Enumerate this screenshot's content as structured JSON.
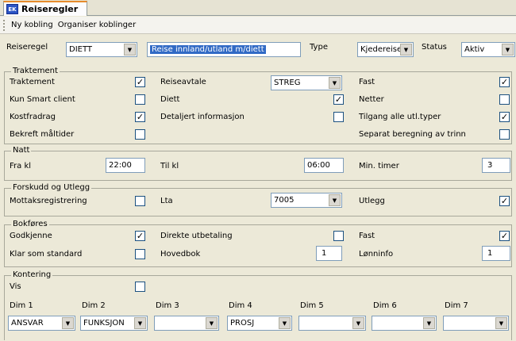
{
  "tab": {
    "icon": "EK",
    "title": "Reiseregler"
  },
  "toolbar": {
    "new_link": "Ny kobling",
    "organize": "Organiser koblinger"
  },
  "header": {
    "reiseregel_label": "Reiseregel",
    "reiseregel_value": "DIETT",
    "description": "Reise innland/utland m/diett",
    "type_label": "Type",
    "type_value": "Kjedereise",
    "status_label": "Status",
    "status_value": "Aktiv"
  },
  "traktement": {
    "title": "Traktement",
    "traktement": "Traktement",
    "kun_smart": "Kun Smart client",
    "kostfradrag": "Kostfradrag",
    "bekreft": "Bekreft måltider",
    "reiseavtale": "Reiseavtale",
    "reiseavtale_value": "STREG",
    "diett": "Diett",
    "detaljert": "Detaljert informasjon",
    "fast": "Fast",
    "netter": "Netter",
    "tilgang": "Tilgang alle utl.typer",
    "separat": "Separat beregning av trinn"
  },
  "natt": {
    "title": "Natt",
    "fra_label": "Fra kl",
    "fra_value": "22:00",
    "til_label": "Til kl",
    "til_value": "06:00",
    "min_label": "Min. timer",
    "min_value": "3"
  },
  "forskudd": {
    "title": "Forskudd og Utlegg",
    "mottak": "Mottaksregistrering",
    "lta": "Lta",
    "lta_value": "7005",
    "utlegg": "Utlegg"
  },
  "bokfores": {
    "title": "Bokføres",
    "godkjenne": "Godkjenne",
    "klar": "Klar som standard",
    "direkte": "Direkte utbetaling",
    "hovedbok": "Hovedbok",
    "hovedbok_value": "1",
    "fast": "Fast",
    "lonninfo": "Lønninfo",
    "lonninfo_value": "1"
  },
  "kontering": {
    "title": "Kontering",
    "vis": "Vis",
    "dims": [
      {
        "label": "Dim 1",
        "value": "ANSVAR"
      },
      {
        "label": "Dim 2",
        "value": "FUNKSJON"
      },
      {
        "label": "Dim 3",
        "value": ""
      },
      {
        "label": "Dim 4",
        "value": "PROSJ"
      },
      {
        "label": "Dim 5",
        "value": ""
      },
      {
        "label": "Dim 6",
        "value": ""
      },
      {
        "label": "Dim 7",
        "value": ""
      }
    ]
  },
  "check_mark": "✓",
  "dropdown_arrow": "▼"
}
